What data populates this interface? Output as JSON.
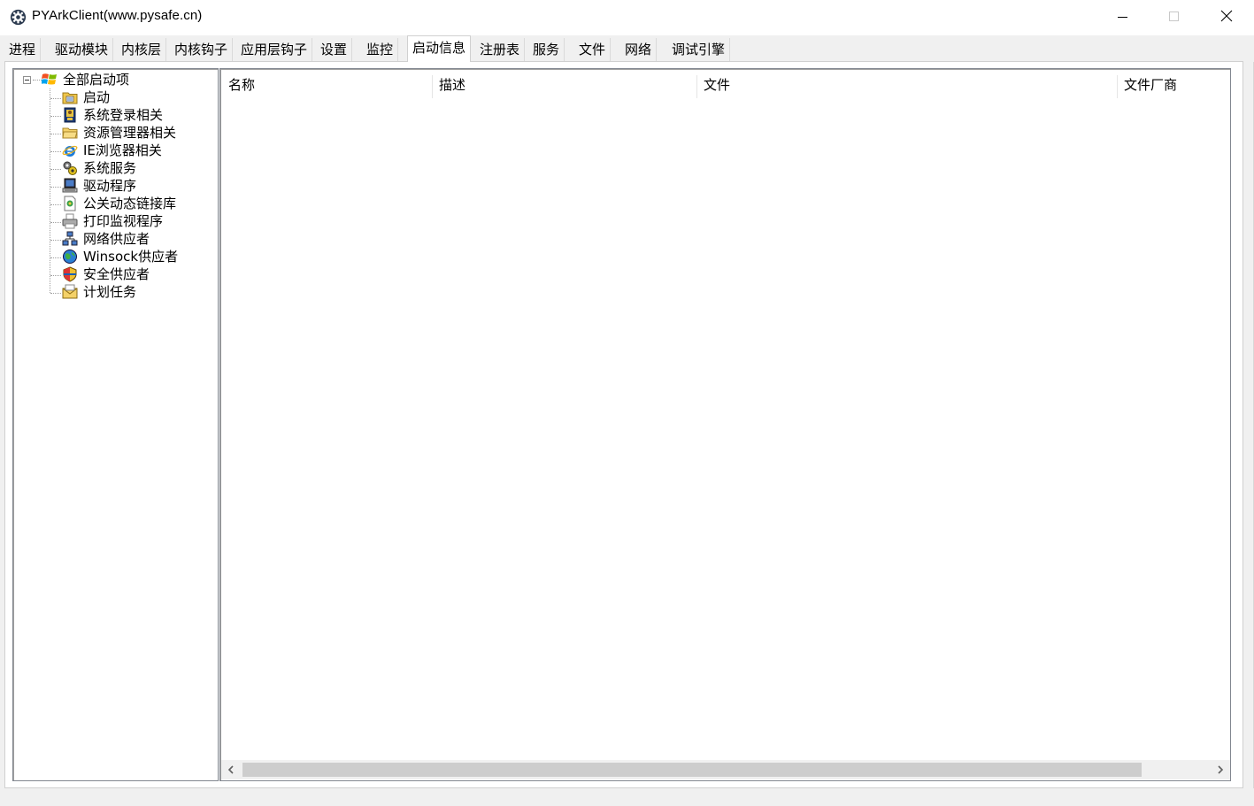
{
  "window": {
    "title": "PYArkClient(www.pysafe.cn)",
    "icon": "gear-icon",
    "controls": {
      "minimize": "minimize-icon",
      "maximize": "maximize-icon",
      "close": "close-icon"
    }
  },
  "tabs": [
    {
      "label": "进程",
      "active": false
    },
    {
      "label": "驱动模块",
      "active": false
    },
    {
      "label": "内核层",
      "active": false
    },
    {
      "label": "内核钩子",
      "active": false
    },
    {
      "label": "应用层钩子",
      "active": false
    },
    {
      "label": "设置",
      "active": false
    },
    {
      "label": "监控",
      "active": false
    },
    {
      "label": "启动信息",
      "active": true
    },
    {
      "label": "注册表",
      "active": false
    },
    {
      "label": "服务",
      "active": false
    },
    {
      "label": "文件",
      "active": false
    },
    {
      "label": "网络",
      "active": false
    },
    {
      "label": "调试引擎",
      "active": false
    }
  ],
  "tree": {
    "root": {
      "label": "全部启动项",
      "icon": "windows-logo-icon",
      "expanded": true
    },
    "children": [
      {
        "label": "启动",
        "icon": "folder-icon"
      },
      {
        "label": "系统登录相关",
        "icon": "login-icon"
      },
      {
        "label": "资源管理器相关",
        "icon": "explorer-folder-icon"
      },
      {
        "label": "IE浏览器相关",
        "icon": "ie-browser-icon"
      },
      {
        "label": "系统服务",
        "icon": "service-gears-icon"
      },
      {
        "label": "驱动程序",
        "icon": "computer-driver-icon"
      },
      {
        "label": "公关动态链接库",
        "icon": "dll-icon"
      },
      {
        "label": "打印监视程序",
        "icon": "printer-icon"
      },
      {
        "label": "网络供应者",
        "icon": "network-icon"
      },
      {
        "label": "Winsock供应者",
        "icon": "globe-icon"
      },
      {
        "label": "安全供应者",
        "icon": "shield-icon"
      },
      {
        "label": "计划任务",
        "icon": "scheduled-task-icon"
      }
    ]
  },
  "list": {
    "columns": [
      "名称",
      "描述",
      "文件",
      "文件厂商"
    ],
    "rows": []
  },
  "scrollbar": {
    "left_arrow": "chevron-left-icon",
    "right_arrow": "chevron-right-icon"
  }
}
